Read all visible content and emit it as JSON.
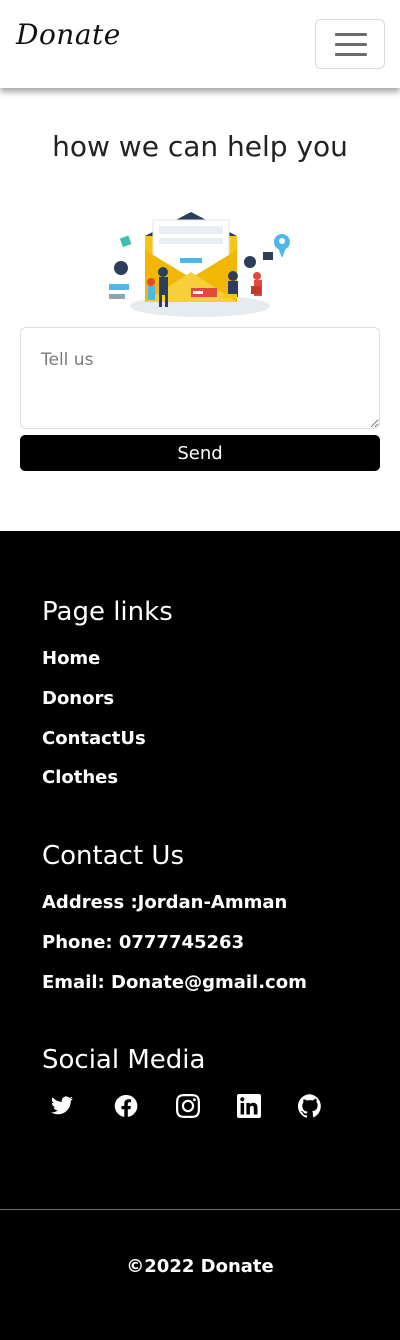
{
  "navbar": {
    "brand": "Donate",
    "toggle_icon": "hamburger-menu-icon"
  },
  "help": {
    "title": "how we can help you",
    "illustration": "contact-envelope-illustration"
  },
  "form": {
    "message_placeholder": "Tell us",
    "message_value": "",
    "send_label": "Send"
  },
  "footer": {
    "page_links_title": "Page links",
    "links": [
      "Home",
      "Donors",
      "ContactUs",
      "Clothes"
    ],
    "contact_title": "Contact Us",
    "contact_lines": [
      "Address :Jordan-Amman",
      "Phone: 0777745263",
      "Email: Donate@gmail.com"
    ],
    "social_title": "Social Media",
    "social_icons": [
      "twitter-icon",
      "facebook-icon",
      "instagram-icon",
      "linkedin-icon",
      "github-icon"
    ],
    "copyright": "©2022 Donate"
  },
  "colors": {
    "footer_bg": "#000000",
    "button_bg": "#000000",
    "accent_yellow": "#f5c518",
    "accent_blue": "#4db8e8"
  }
}
